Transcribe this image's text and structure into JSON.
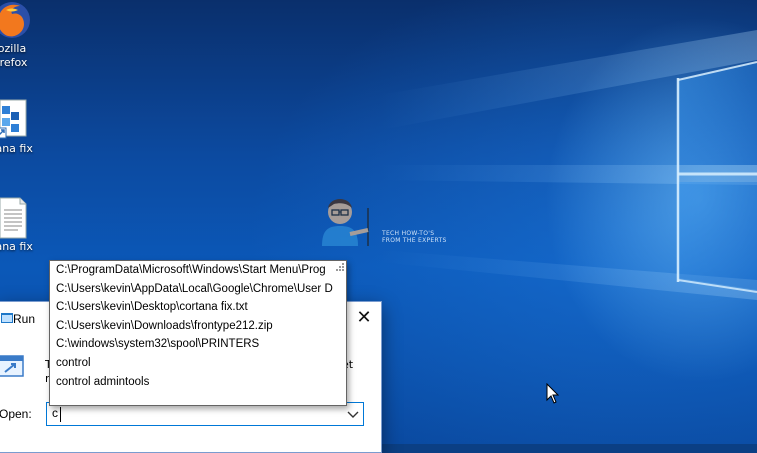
{
  "desktop": {
    "icons": [
      {
        "id": "firefox",
        "label_line1": "ozilla",
        "label_line2": "irefox"
      },
      {
        "id": "cortana-fix-shortcut",
        "label": "tana fix"
      },
      {
        "id": "cortana-fix-txt",
        "label": "tana fix"
      }
    ],
    "watermark_text": "TECH HOW-TO'S FROM THE EXPERTS"
  },
  "run_dialog": {
    "title": "Run",
    "close_glyph": "✕",
    "open_label": "Open:",
    "input_value": "c",
    "description_fragment_left": "T",
    "description_fragment_left2": "r",
    "description_fragment_right": "et"
  },
  "autocomplete": {
    "items": [
      "C:\\ProgramData\\Microsoft\\Windows\\Start Menu\\Prog",
      "C:\\Users\\kevin\\AppData\\Local\\Google\\Chrome\\User D",
      "C:\\Users\\kevin\\Desktop\\cortana fix.txt",
      "C:\\Users\\kevin\\Downloads\\frontype212.zip",
      "C:\\windows\\system32\\spool\\PRINTERS",
      "control",
      "control admintools"
    ]
  },
  "colors": {
    "accent": "#0078d7",
    "wallpaper_dark": "#0a2f6c",
    "wallpaper_light": "#0b58b8"
  }
}
